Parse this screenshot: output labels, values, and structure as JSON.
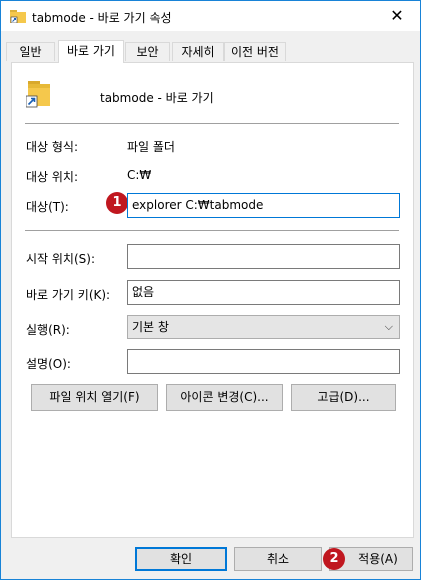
{
  "window": {
    "title": "tabmode - 바로 가기 속성",
    "close_glyph": "✕"
  },
  "tabs": [
    {
      "label": "일반",
      "active": false
    },
    {
      "label": "바로 가기",
      "active": true
    },
    {
      "label": "보안",
      "active": false
    },
    {
      "label": "자세히",
      "active": false
    },
    {
      "label": "이전 버전",
      "active": false
    }
  ],
  "header": {
    "name": "tabmode - 바로 가기",
    "icon": "shortcut-folder-icon"
  },
  "info": {
    "type_label": "대상 형식:",
    "type_value": "파일 폴더",
    "location_label": "대상 위치:",
    "location_value": "C:₩"
  },
  "target": {
    "label": "대상(T):",
    "value": "explorer C:₩tabmode",
    "badge": "1"
  },
  "start_in": {
    "label": "시작 위치(S):",
    "value": ""
  },
  "shortcut_key": {
    "label": "바로 가기 키(K):",
    "value": "없음"
  },
  "run": {
    "label": "실행(R):",
    "value": "기본 창",
    "chevron": "⌵"
  },
  "comment": {
    "label": "설명(O):",
    "value": ""
  },
  "actions": {
    "open_location": "파일 위치 열기(F)",
    "change_icon": "아이콘 변경(C)...",
    "advanced": "고급(D)..."
  },
  "footer": {
    "ok": "확인",
    "cancel": "취소",
    "apply": "적용(A)",
    "badge": "2"
  },
  "colors": {
    "accent": "#0078d7",
    "badge": "#c0171f",
    "border": "#1883d7"
  }
}
